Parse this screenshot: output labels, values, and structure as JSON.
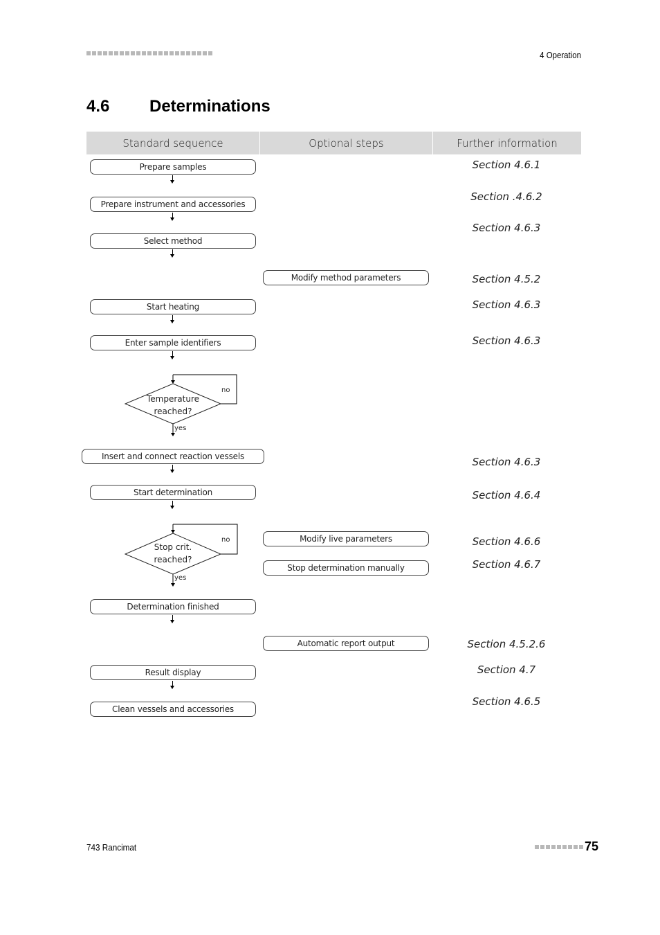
{
  "header": {
    "running_head": "4 Operation",
    "squares_count": 23
  },
  "section": {
    "number": "4.6",
    "title": "Determinations"
  },
  "table": {
    "columns": [
      "Standard sequence",
      "Optional steps",
      "Further information"
    ]
  },
  "flow": {
    "standard_steps": [
      {
        "label": "Prepare samples",
        "ref": "Section 4.6.1"
      },
      {
        "label": "Prepare instrument and accessories",
        "ref": "Section .4.6.2"
      },
      {
        "label": "Select method",
        "ref": "Section 4.6.3"
      },
      {
        "label": "Start heating",
        "ref": "Section 4.6.3"
      },
      {
        "label": "Enter sample identifiers",
        "ref": "Section 4.6.3"
      },
      {
        "label": "Insert and connect reaction vessels",
        "ref": "Section 4.6.3"
      },
      {
        "label": "Start determination",
        "ref": "Section 4.6.4"
      },
      {
        "label": "Determination finished",
        "ref": ""
      },
      {
        "label": "Result display",
        "ref": "Section 4.7"
      },
      {
        "label": "Clean vessels and accessories",
        "ref": "Section 4.6.5"
      }
    ],
    "optional_steps": [
      {
        "label": "Modify method parameters",
        "ref": "Section 4.5.2"
      },
      {
        "label": "Modify live parameters",
        "ref": "Section 4.6.6"
      },
      {
        "label": "Stop determination manually",
        "ref": "Section 4.6.7"
      },
      {
        "label": "Automatic report output",
        "ref": "Section 4.5.2.6"
      }
    ],
    "decisions": [
      {
        "line1": "Temperature",
        "line2": "reached?",
        "no_label": "no",
        "yes_label": "yes"
      },
      {
        "line1": "Stop crit.",
        "line2": "reached?",
        "no_label": "no",
        "yes_label": "yes"
      }
    ]
  },
  "footer": {
    "product": "743 Rancimat",
    "page_number": "75",
    "squares_count": 9
  }
}
